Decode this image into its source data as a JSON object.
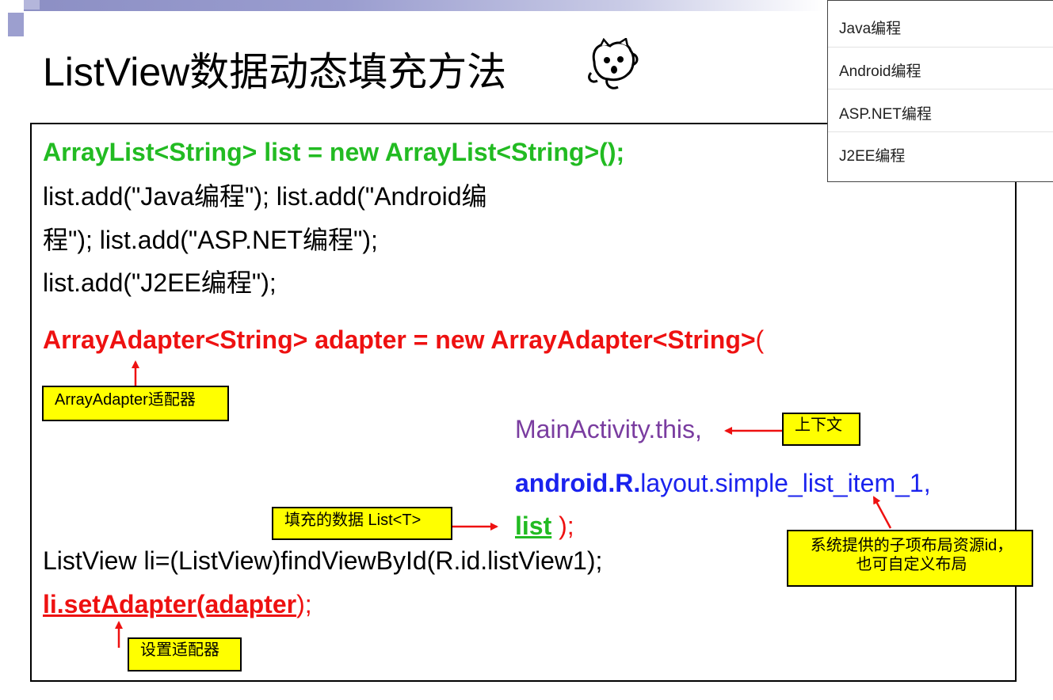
{
  "slide": {
    "title": "ListView数据动态填充方法",
    "code": {
      "line1": "ArrayList<String> list  = new ArrayList<String>();",
      "line2": "list.add(\"Java编程\"); list.add(\"Android编",
      "line3": "程\"); list.add(\"ASP.NET编程\");",
      "line4": "list.add(\"J2EE编程\");",
      "line5_main": "ArrayAdapter<String> adapter = new ArrayAdapter<String>",
      "line5_paren": "(",
      "line6": "MainActivity.this,",
      "line7_bold": "android.R.",
      "line7_rest": "layout.simple_list_item_1,",
      "line8_list": "list",
      "line8_close": "  );",
      "line9": "ListView li=(ListView)findViewById(R.id.listView1);",
      "line10_main": "li.setAdapter(adapter",
      "line10_close": ");"
    },
    "notes": {
      "adapter": "ArrayAdapter适配器",
      "context": "上下文",
      "data": "填充的数据 List<T>",
      "resource_line1": "系统提供的子项布局资源id，",
      "resource_line2": "也可自定义布局",
      "set_adapter": "设置适配器"
    }
  },
  "popup_list": {
    "items": [
      "Java编程",
      "Android编程",
      "ASP.NET编程",
      "J2EE编程"
    ]
  },
  "colors": {
    "green": "#22bb22",
    "red": "#ee1111",
    "purple": "#7a3da0",
    "blue": "#1a22ee",
    "note_bg": "#ffff00"
  }
}
